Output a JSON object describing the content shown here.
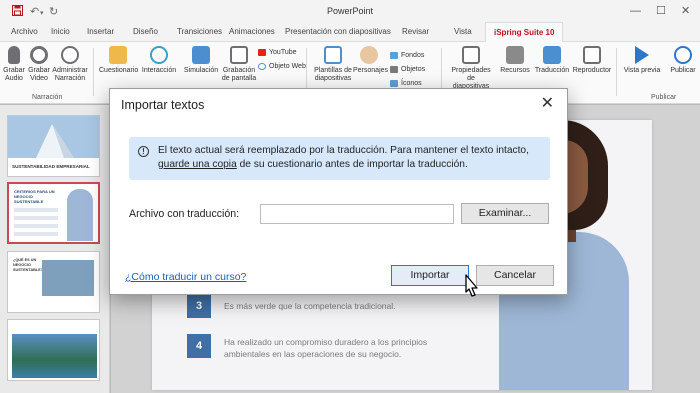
{
  "titlebar": {
    "title": "PowerPoint",
    "save_icon": "save-icon",
    "undo_icon": "undo-icon",
    "redo_icon": "redo-icon",
    "minimize": "—",
    "maximize": "☐",
    "close": "✕"
  },
  "tabs": [
    "Archivo",
    "Inicio",
    "Insertar",
    "Diseño",
    "Transiciones",
    "Animaciones",
    "Presentación con diapositivas",
    "Revisar",
    "Vista",
    "iSpring Suite 10"
  ],
  "ribbon": {
    "narration": {
      "buttons": [
        "Grabar Audio",
        "Grabar Video",
        "Administrar Narración"
      ],
      "group_label": "Narración"
    },
    "insert": {
      "buttons": [
        "Cuestionario",
        "Interacción",
        "Simulación",
        "Grabación de pantalla"
      ],
      "small_items": [
        "YouTube",
        "Objeto Web"
      ]
    },
    "content": {
      "buttons": [
        "Plantillas de diapositivas",
        "Personajes"
      ],
      "small_items": [
        "Fondos",
        "Objetos",
        "Íconos"
      ]
    },
    "presentation": {
      "buttons": [
        "Propiedades de diapositivas",
        "Recursos",
        "Traducción",
        "Reproductor"
      ]
    },
    "publish": {
      "buttons": [
        "Vista previa",
        "Publicar"
      ],
      "group_label": "Publicar"
    }
  },
  "thumbnails": {
    "slide1_caption": "SUSTENTABILIDAD EMPRESARIAL",
    "slide2_caption": "CRITERIOS PARA UN NEGOCIO SUSTENTABLE",
    "slide3_caption": "¿QUÉ ES UN NEGOCIO SUSTENTABLE?"
  },
  "slide": {
    "steps": [
      {
        "num": "3",
        "text": "Es más verde que la competencia tradicional."
      },
      {
        "num": "4",
        "text": "Ha realizado un compromiso duradero a los principios ambientales en las operaciones de su negocio."
      }
    ]
  },
  "dialog": {
    "title": "Importar textos",
    "close_label": "✕",
    "info_before": "El texto actual será reemplazado por la traducción. Para mantener el texto intacto, ",
    "info_link": "guarde una copia",
    "info_after": " de su cuestionario antes de importar la traducción.",
    "field_label": "Archivo con traducción:",
    "field_value": "",
    "browse": "Examinar...",
    "help_link": "¿Cómo traducir un curso?",
    "import": "Importar",
    "cancel": "Cancelar"
  }
}
